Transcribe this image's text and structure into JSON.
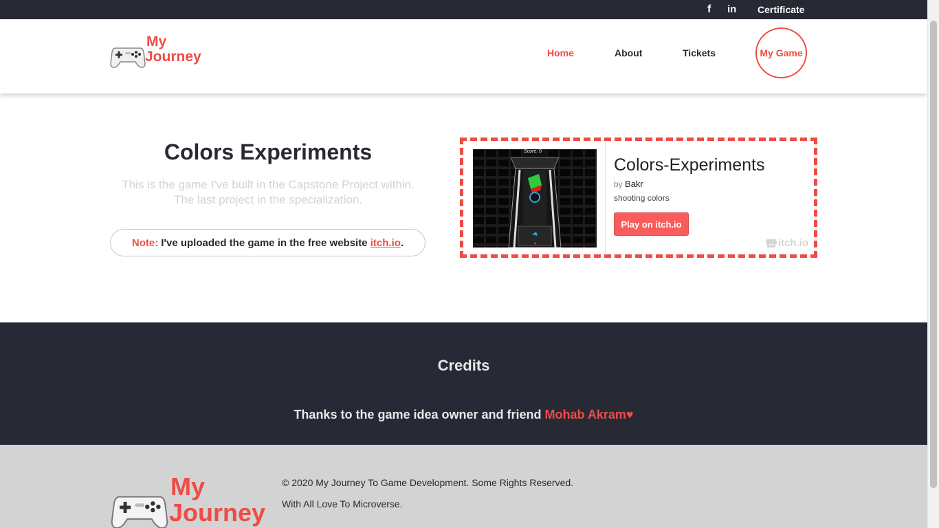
{
  "topbar": {
    "facebook_icon": "facebook-icon",
    "facebook_glyph": "f",
    "linkedin_icon": "linkedin-icon",
    "linkedin_glyph": "in",
    "certificate_label": "Certificate"
  },
  "header": {
    "logo_line1": "My",
    "logo_line2": "Journey",
    "nav": {
      "home": "Home",
      "about": "About",
      "tickets": "Tickets",
      "my_game": "My Game"
    }
  },
  "main": {
    "title": "Colors Experiments",
    "description_line1": "This is the game I've built in the Capstone Project within.",
    "description_line2": "The last project in the specialization.",
    "note_label": "Note:",
    "note_text": "I've uploaded the game in the free website",
    "note_link": "itch.io",
    "note_end": "."
  },
  "widget": {
    "score_text": "Score: 0",
    "game_name": "Colors-Experiments",
    "by_label": "by",
    "author": "Bakr",
    "game_description": "shooting colors",
    "play_button": "Play on itch.io",
    "brand": "itch.io"
  },
  "credits": {
    "title": "Credits",
    "thanks_text": "Thanks to the game idea owner and friend",
    "friend_name": "Mohab Akram",
    "heart": "♥"
  },
  "footer": {
    "logo_line1": "My",
    "logo_line2": "Journey",
    "copyright": "© 2020 My Journey To Game Development. Some Rights Reserved.",
    "love": "With All Love To Microverse."
  },
  "colors": {
    "accent": "#ee4c45",
    "dark": "#272a34",
    "footer_bg": "#d3d3d3",
    "itch_button": "#fa5c5c"
  }
}
